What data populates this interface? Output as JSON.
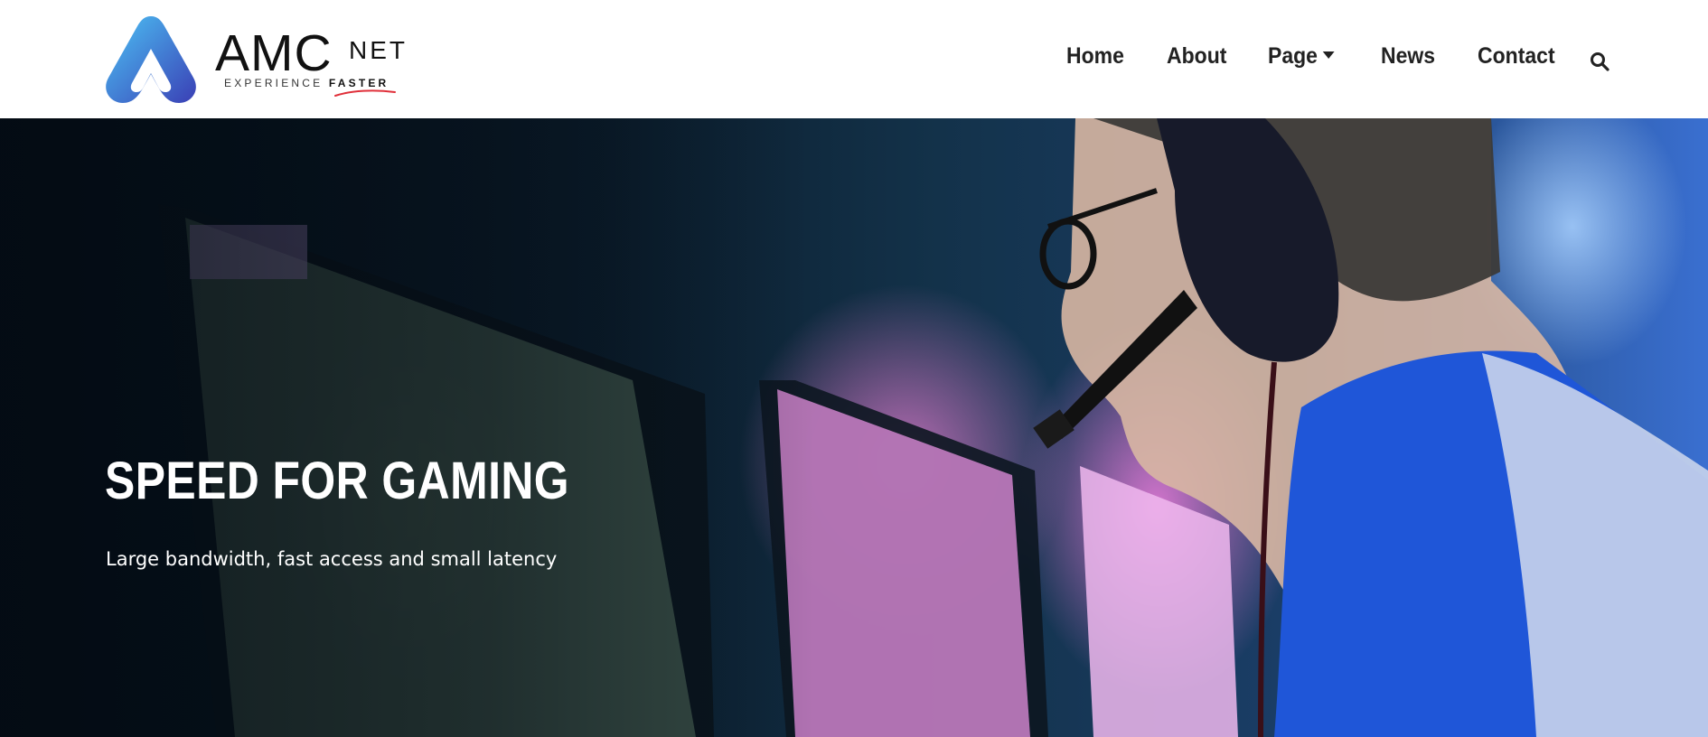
{
  "brand": {
    "logo_main": "AMC",
    "logo_suffix": "NET",
    "tagline_prefix": "EXPERIENCE ",
    "tagline_emphasis": "FASTER",
    "logo_gradient_start": "#3ab0f0",
    "logo_gradient_end": "#3b3fb8"
  },
  "nav": {
    "items": [
      {
        "label": "Home"
      },
      {
        "label": "About"
      },
      {
        "label": "Page"
      },
      {
        "label": "News"
      },
      {
        "label": "Contact"
      }
    ],
    "search_icon": "search-icon",
    "dropdown_icon": "caret-down-icon"
  },
  "hero": {
    "title": "SPEED FOR GAMING",
    "subtitle": "Large bandwidth, fast access and small latency"
  }
}
